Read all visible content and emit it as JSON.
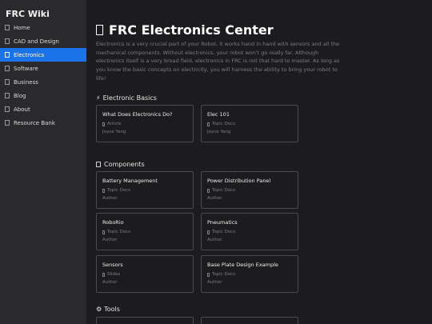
{
  "brand": "FRC Wiki",
  "nav": [
    {
      "label": "Home",
      "active": false
    },
    {
      "label": "CAD and Design",
      "active": false
    },
    {
      "label": "Electronics",
      "active": true
    },
    {
      "label": "Software",
      "active": false
    },
    {
      "label": "Business",
      "active": false
    },
    {
      "label": "Blog",
      "active": false
    },
    {
      "label": "About",
      "active": false
    },
    {
      "label": "Resource Bank",
      "active": false
    }
  ],
  "page": {
    "title": "FRC Electronics Center",
    "intro": "Electronics is a very crucial part of your Robot, it works hand in hand with sensors and all the mechanical components. Without electronics, your robot won't go really far. Although electronics itself is a very broad field, electronics in FRC is not that hard to master. As long as you know the basic concepts on electricity, you will harness the ability to bring your robot to life!"
  },
  "sections": {
    "basics": {
      "icon": "⚡",
      "title": "Electronic Basics",
      "cards": [
        {
          "title": "What Does Electronics Do?",
          "type": "Article",
          "author": "Joyce Yang"
        },
        {
          "title": "Elec 101",
          "type": "Topic Docs",
          "author": "Joyce Yang"
        }
      ]
    },
    "components": {
      "title": "Components",
      "cards": [
        {
          "title": "Battery Management",
          "type": "Topic Docs",
          "author": "Author"
        },
        {
          "title": "Power Distribution Panel",
          "type": "Topic Docs",
          "author": "Author"
        },
        {
          "title": "RoboRio",
          "type": "Topic Docs",
          "author": "Author"
        },
        {
          "title": "Pneumatics",
          "type": "Topic Docs",
          "author": "Author"
        },
        {
          "title": "Sensors",
          "type": "Slides",
          "author": "Author"
        },
        {
          "title": "Base Plate Design Example",
          "type": "Topic Docs",
          "author": "Author"
        }
      ]
    },
    "tools": {
      "icon": "⚙",
      "title": "Tools"
    }
  }
}
